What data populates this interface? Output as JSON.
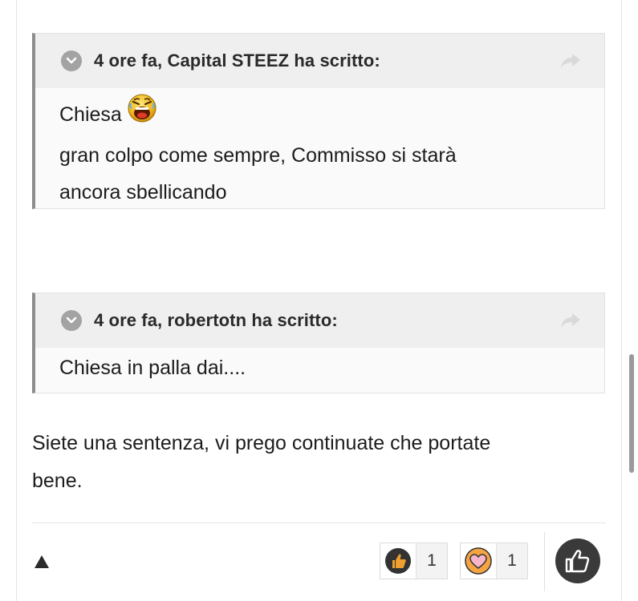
{
  "quotes": [
    {
      "citation": "4 ore fa, Capital STEEZ ha scritto:",
      "lines": [
        "Chiesa",
        "gran colpo come sempre, Commisso si starà",
        "ancora sbellicando"
      ],
      "emoji": "laughing-emoji"
    },
    {
      "citation": "4 ore fa, robertotn ha scritto:",
      "lines": [
        "Chiesa in palla dai...."
      ]
    }
  ],
  "post": {
    "lines": [
      "Siete una sentenza, vi prego continuate che portate",
      "bene."
    ]
  },
  "footer": {
    "reactions": [
      {
        "icon": "thumbs-up-icon",
        "count": "1",
        "color": "#f0a030"
      },
      {
        "icon": "heart-icon",
        "count": "1",
        "color": "#f6b5c8"
      }
    ],
    "react_icon": "thumbs-up-icon"
  },
  "colors": {
    "quote_border": "#8d8d8d",
    "quote_header_bg": "#efefef",
    "react_button_bg": "#3a3a3a"
  }
}
